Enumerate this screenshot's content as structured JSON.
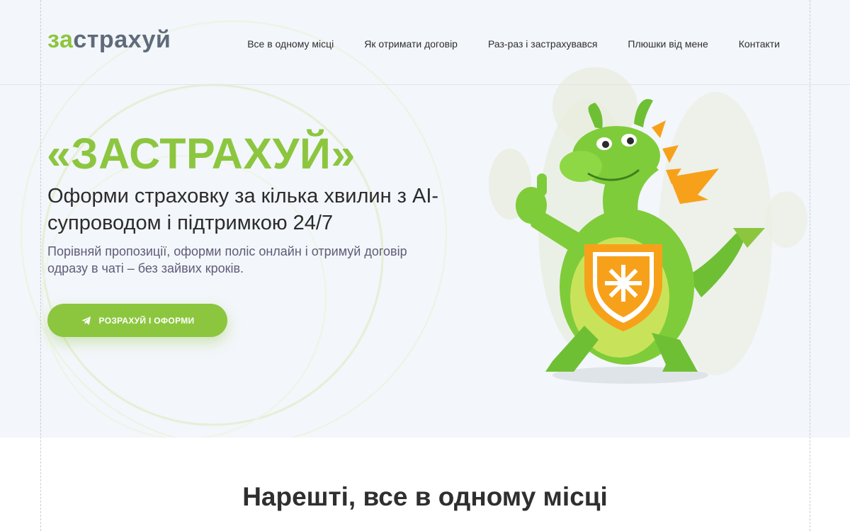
{
  "header": {
    "logo_part1": "за",
    "logo_part2": "страхуй",
    "nav": [
      {
        "label": "Все в одному місці"
      },
      {
        "label": "Як отримати договір"
      },
      {
        "label": "Раз-раз і застрахувався"
      },
      {
        "label": "Плюшки від мене"
      },
      {
        "label": "Контакти"
      }
    ]
  },
  "hero": {
    "title": "«ЗАСТРАХУЙ»",
    "subtitle": "Оформи страховку за кілька хвилин з AI-супроводом і підтримкою 24/7",
    "description": "Порівняй пропозиції, оформи поліс онлайн і отримуй договір одразу в чаті – без зайвих кроків.",
    "cta_label": "РОЗРАХУЙ І ОФОРМИ",
    "cta_icon": "telegram-plane-icon"
  },
  "section": {
    "title": "Нарешті, все в одному місці"
  },
  "colors": {
    "brand_green": "#8cc63f",
    "logo_gray": "#5f6b7a",
    "hero_bg": "#f3f6fa",
    "shield_orange": "#f7a11a"
  }
}
